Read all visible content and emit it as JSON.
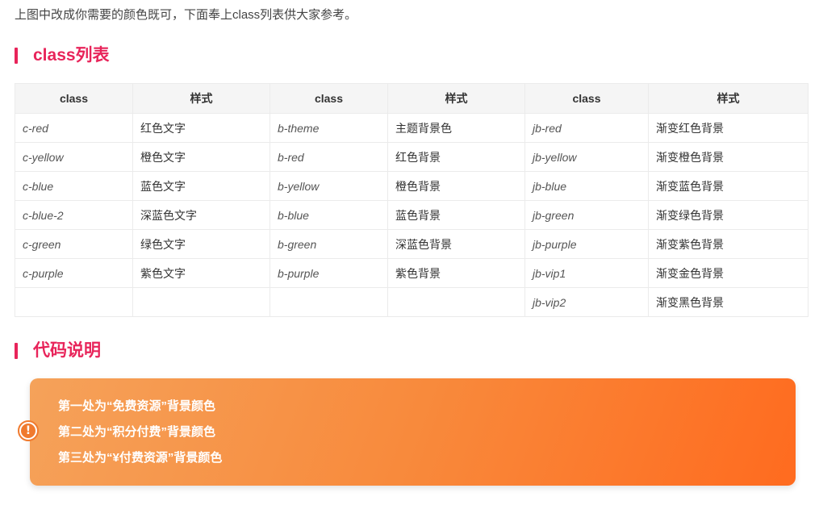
{
  "intro": "上图中改成你需要的颜色既可，下面奉上class列表供大家参考。",
  "sections": {
    "class_list_title": "class列表",
    "code_notes_title": "代码说明"
  },
  "table": {
    "headers": [
      "class",
      "样式",
      "class",
      "样式",
      "class",
      "样式"
    ],
    "rows": [
      [
        "c-red",
        "红色文字",
        "b-theme",
        "主题背景色",
        "jb-red",
        "渐变红色背景"
      ],
      [
        "c-yellow",
        "橙色文字",
        "b-red",
        "红色背景",
        "jb-yellow",
        "渐变橙色背景"
      ],
      [
        "c-blue",
        "蓝色文字",
        "b-yellow",
        "橙色背景",
        "jb-blue",
        "渐变蓝色背景"
      ],
      [
        "c-blue-2",
        "深蓝色文字",
        "b-blue",
        "蓝色背景",
        "jb-green",
        "渐变绿色背景"
      ],
      [
        "c-green",
        "绿色文字",
        "b-green",
        "深蓝色背景",
        "jb-purple",
        "渐变紫色背景"
      ],
      [
        "c-purple",
        "紫色文字",
        "b-purple",
        "紫色背景",
        "jb-vip1",
        "渐变金色背景"
      ],
      [
        "",
        "",
        "",
        "",
        "jb-vip2",
        "渐变黑色背景"
      ]
    ]
  },
  "notice": {
    "icon": "exclamation-icon",
    "icon_glyph": "!",
    "lines": [
      "第一处为“免费资源”背景颜色",
      "第二处为“积分付费”背景颜色",
      "第三处为“¥付费资源”背景颜色"
    ]
  },
  "colors": {
    "accent": "#e8245a",
    "notice_gradient_start": "#f5a25a",
    "notice_gradient_end": "#ff6b1f"
  }
}
